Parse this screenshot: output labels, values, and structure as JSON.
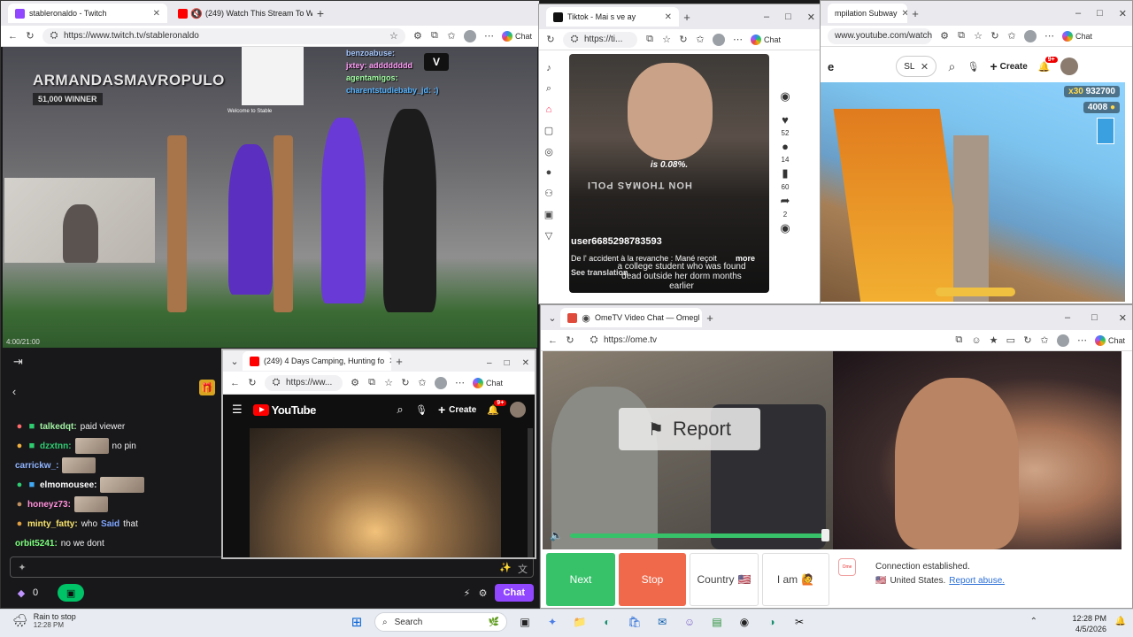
{
  "twitch": {
    "tabs": [
      {
        "label": "stableronaldo - Twitch"
      },
      {
        "label": "(249) Watch This Stream To W"
      }
    ],
    "url": "https://www.twitch.tv/stableronaldo",
    "chat_label": "Chat",
    "overlay_name": "ARMANDASMAVROPULO",
    "overlay_winner": "51,000 WINNER",
    "overlay_welcome": "Welcome to Stable",
    "overlay_chat": [
      {
        "user": "benzoabuse:",
        "text": ""
      },
      {
        "user": "jxtey:",
        "text": "adddddddd"
      },
      {
        "user": "agentamigos:",
        "text": ""
      },
      {
        "user": "charentstudiebaby_jd:",
        "text": ":)"
      }
    ],
    "timecode": "4:00/21:00",
    "chat_messages": [
      {
        "user": "talkedqt:",
        "text": "paid viewer",
        "color": "#a1f0a1"
      },
      {
        "user": "dzxtnn:",
        "text": "no pin",
        "color": "#2ecc71"
      },
      {
        "user": "carrickw_:",
        "text": "",
        "color": "#8fb4ff"
      },
      {
        "user": "elmomousee:",
        "text": "",
        "color": "#ffffff"
      },
      {
        "user": "honeyz73:",
        "text": "",
        "color": "#ff8fd8"
      },
      {
        "user": "minty_fatty:",
        "text": "who",
        "text2": "Said",
        "text3": "that",
        "color": "#f7e26b"
      },
      {
        "user": "orbit5241:",
        "text": "no we dont",
        "color": "#7cff7c"
      }
    ],
    "points": "0",
    "chat_button": "Chat"
  },
  "yt_small": {
    "tab": "(249) 4 Days Camping, Hunting fo",
    "url": "https://ww...",
    "chat_label": "Chat",
    "logo": "YouTube",
    "create": "Create",
    "badge": "9+"
  },
  "tiktok": {
    "tab": "Tiktok - Mai s ve ay",
    "url": "https://ti...",
    "chat_label": "Chat",
    "caption": "is 0.08%.",
    "plate": "HON THOMAS POLI",
    "user": "user6685298783593",
    "desc": "De l' accident à la revanche : Mané reçoit",
    "more": "more",
    "translation": "See translation",
    "subtitle": "a college student who was found dead outside her dorm months earlier",
    "rail_counts": [
      "52",
      "14",
      "60",
      "2"
    ]
  },
  "yt_subway": {
    "tab": "mpilation Subway",
    "url": "www.youtube.com/watch?...",
    "chat_label": "Chat",
    "logo_partial": "e",
    "search_text": "SL",
    "create": "Create",
    "badge": "9+",
    "score": "932700",
    "multiplier": "x30",
    "coins": "4008"
  },
  "ometv": {
    "tab": "OmeTV Video Chat — Omegl",
    "url": "https://ome.tv",
    "chat_label": "Chat",
    "report": "Report",
    "buttons": {
      "next": "Next",
      "stop": "Stop",
      "country": "Country",
      "iam": "I am"
    },
    "status_title": "Connection established.",
    "status_country": "United States.",
    "status_link": "Report abuse.",
    "logo": "Ome"
  },
  "taskbar": {
    "weather_title": "Rain to stop",
    "weather_time": "12:28 PM",
    "search": "Search",
    "clock_time": "12:28 PM",
    "clock_date": "4/5/2026"
  },
  "colors": {
    "twitch_purple": "#9147ff",
    "ome_next": "#37c26a",
    "ome_stop": "#f0694b",
    "yt_red": "#ff0000"
  }
}
